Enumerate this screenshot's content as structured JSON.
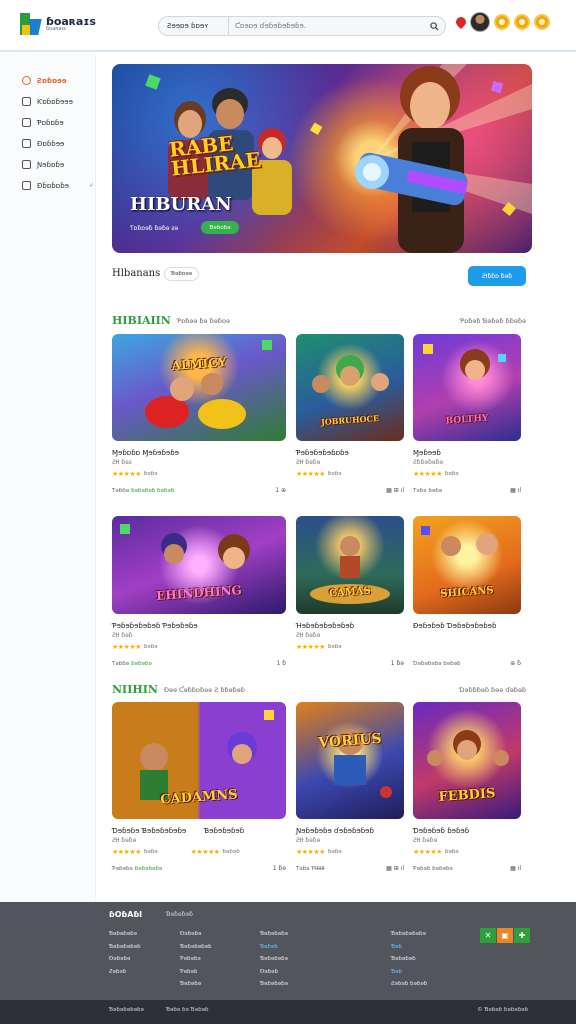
{
  "header": {
    "logo_name": "ɓoaʀaɪs",
    "logo_sub": "ɓoaʀaɪs",
    "search_category": "Ƨɘɘɒɘ ɓɒɘʏ",
    "search_placeholder": "Ƈɒɘɒɘ ɗɘɓɘɓɘɓɘɓɘ."
  },
  "sidebar": {
    "items": [
      {
        "label": "Ƨɒɓɒɘɘ",
        "active": true,
        "icon": "home-icon"
      },
      {
        "label": "Ƙɒɓɒɓɘɘɘ",
        "active": false,
        "icon": "gamepad-icon"
      },
      {
        "label": "Ƥɒɓɒɓɘ",
        "active": false,
        "icon": "news-icon"
      },
      {
        "label": "Ɖɒɓɓɘɘ",
        "active": false,
        "icon": "trophy-icon"
      },
      {
        "label": "Ɲɘɓɒɓɘ",
        "active": false,
        "icon": "chat-icon"
      },
      {
        "label": "Ɖɓɒɓɒɓɘ",
        "active": false,
        "icon": "folder-icon",
        "chevron": "✓"
      }
    ]
  },
  "hero": {
    "tag_line1": "RABE",
    "tag_line2": "HLIRAE",
    "title": "HIBURAN",
    "meta": "Ƭɒɓɒɘɓ ɓɘɓɘ  ƨɘ",
    "cta": "Ɓɘɓɒɓɘ"
  },
  "section": {
    "title": "Hlbanans",
    "chip": "Ɓɘɓɒɘɘ",
    "cta": "ƧƗɓɓɒ ɓɘɓ"
  },
  "rows": [
    {
      "head": "HIBIAIIN",
      "sub": "Ƥɒɓɘɘ ɓɘ ɓɘɓɒɘ",
      "right": "Ƥɒɓɘɓ Ɓɘɓɘɓ ɓɓɘɓɘ"
    },
    {
      "head": "NIIHIN",
      "sub": "Ɖɘɘ Ƈɘɓɓɒɓɘɘ Ƨ ɓɓɘɓɘɓ",
      "right": "Ɗɘɓɓɓɘɓ ɓɘɘ ɗɘɓɘɓ"
    }
  ],
  "cards": [
    {
      "title": "Ɱɘɓɒɓɒ Ɱɘɓɘɓɘɓɘ",
      "sub": "ƧƗƗ ɓɘƨ",
      "count": "ɓɘɓɘ",
      "foot": "Ƭɘɓɓɘ",
      "foot_green": "ɓɘɓɘɓɘɓ ɓɘɓɘɓ",
      "ico": "1  ⊕",
      "glyph": "ALMICY"
    },
    {
      "title": "Ƥɘɓɘɓɘɓɘɓɒɓɘ",
      "sub": "ƧƗƗ ɓɘɓɘ",
      "count": "ɓɘɓɘ",
      "foot": "",
      "foot_green": "",
      "ico": "▦     ⊞   ıl",
      "glyph": "JOBRUHOCE"
    },
    {
      "title": "Ɱɘɓɘɘɓ",
      "sub": "Ƨɓɓɘɓɘɓɘ",
      "count": "ɓɘɓɘ",
      "foot": "Ƭɘɓɘ ɓɘɓɘ",
      "foot_green": "",
      "ico": "▦     ıl",
      "glyph": "BOLTHY"
    },
    {
      "title": "Ƥɘɓɘɓɘɓɘɓɘɓ Ƥɘɓɘɓɘɓɘ",
      "sub": "ƧƗƗ ɓɘɓ",
      "count": "ɓɘɓɘ",
      "foot": "Ƭɘɓɓɘ",
      "foot_green": "ɓɘɓɘɓɘ",
      "ico": "1  ɓ",
      "glyph": "EHINDHING"
    },
    {
      "title": "Ɦɘɓɘɓɘɓɘɓɘɓɘɓ",
      "sub": "ƧƗƗ ɓɘɓɘ",
      "count": "ɓɘɓɘ",
      "foot": "",
      "foot_green": "",
      "ico": "1  ɓɘ",
      "glyph": "CAMAS"
    },
    {
      "title": "Ɖɘɓɘɓɘɓ Ɗɘɓɘɓɘɓɘɓɘɓ",
      "sub": "",
      "count": "",
      "foot": "Ɗɘɓɘɓɘɓɘ ɓɘɓɘɓ",
      "foot_green": "",
      "ico": "⊕  ɓ",
      "glyph": "SHICANS"
    },
    {
      "title": "Ɗɘɓɘɓɘ Ɓɘɓɘɓɘɓɘɓɘ",
      "sub": "ƧƗƗ ɓɘɓɘ",
      "count": "ɓɘɓɘ",
      "foot": "Ƥɘɓɘɓɘ",
      "foot_green": "ɓɘɓɘɓɘɓɘ",
      "ico": "",
      "glyph": "CADAMNS"
    },
    {
      "title": "Ɓɘɓɘɓɘɓɘɓ",
      "sub": "",
      "count": "ɓɘɓɘɓ",
      "foot": "",
      "foot_green": "",
      "ico": "1  ɓɘ",
      "glyph": ""
    },
    {
      "title": "Ɲɘɓɘɓɘɓɘ ɗɘɓɘɓɘɓɘɓ",
      "sub": "ƧƗƗ ɓɘɓɘ",
      "count": "ɓɘɓɘ",
      "foot": "Ƭɘɓɘ ƤƗƗƗƗƗƗ",
      "foot_green": "",
      "ico": "▦     ⊞   ıl",
      "glyph": "VORIUS"
    },
    {
      "title": "Ɗɘɓɘɓɘɓ ɓɘɓɘɓ",
      "sub": "ƧƗƗ ɓɘɓɘ",
      "count": "ɓɘɓɘ",
      "foot": "Ƥɘɓɘɓ ɓɘɓɘɓɘ",
      "foot_green": "",
      "ico": "▦     ıl",
      "glyph": "FEBDIS"
    }
  ],
  "footer": {
    "brand": "ɓOɓAɓI",
    "brand_sub": "Ɓɘɓɘɓɘɓ",
    "col1": [
      "Ɓɘɓɘɓɘɓɘ",
      "Ɓɘɓɘɓɘɓɘɓ",
      "Ɖɘɓɘɓɘ",
      "Ƨɘɓɘɓ"
    ],
    "col2": [
      "Ɖɘɓɘɓɘ",
      "Ɓɘɓɘɓɘɓɘɓ",
      "Ƥɘɓɘɓɘ",
      "Ƥɘɓɘɓ",
      "Ɓɘɓɘɓɘ"
    ],
    "col3": [
      "Ɓɘɓɘɓɘɓɘ",
      "Ɓɘɓɘɓ",
      "Ɓɘɓɘɓɘɓɘ",
      "Ɖɘɓɘɓ",
      "Ɓɘɓɘɓɘɓɘ"
    ],
    "col4": [
      "Ɓɘɓɘɓɘɓɘɓɘ",
      "Ɓɘɓ",
      "Ɓɘɓɘɓɘɓ",
      "Ɓɘɓ",
      "Ƨɘɓɘɓ ɓɘɓɘɓ"
    ],
    "copyright_left": "Ɓɘɓɘɓɘɓɘɓɘ",
    "copyright_mid": "Ɓɘɓɘ ɓɘ Ɓɘɓɘɓ",
    "copyright_right": "© Ɓɘɓɘɓ ɓɘɓɘɓɘɓ"
  },
  "colors": {
    "accent": "#1e9be9",
    "green": "#2f9f3b",
    "active": "#e8632a",
    "footer": "#53555c"
  }
}
